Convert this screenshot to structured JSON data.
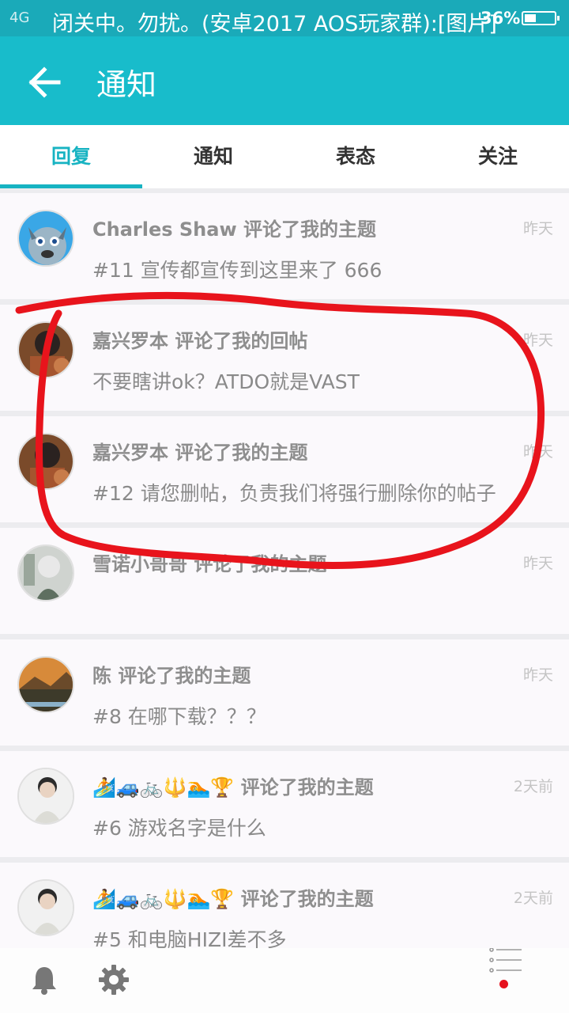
{
  "status_bar": {
    "text": "闭关中。勿扰。(安卓2017 AOS玩家群):[图片]",
    "battery": "36%",
    "signal": "4G"
  },
  "app_bar": {
    "back_icon": "arrow-left-icon",
    "title": "通知"
  },
  "tabs": [
    {
      "label": "回复",
      "active": true
    },
    {
      "label": "通知",
      "active": false
    },
    {
      "label": "表态",
      "active": false
    },
    {
      "label": "关注",
      "active": false
    }
  ],
  "notifications": [
    {
      "title": "Charles Shaw 评论了我的主题",
      "time": "昨天",
      "body": "#11 宣传都宣传到这里来了  666"
    },
    {
      "title": "嘉兴罗本 评论了我的回帖",
      "time": "昨天",
      "body": "不要瞎讲ok？ATDO就是VAST"
    },
    {
      "title": "嘉兴罗本 评论了我的主题",
      "time": "昨天",
      "body": "#12 请您删帖，负责我们将强行删除你的帖子"
    },
    {
      "title": "雪诺小哥哥 评论了我的主题",
      "time": "昨天",
      "body": ""
    },
    {
      "title": "陈 评论了我的主题",
      "time": "昨天",
      "body": "#8 在哪下载？？？"
    },
    {
      "title": "🏄🚙🚲🔱🏊🏆 评论了我的主题",
      "time": "2天前",
      "body": "#6 游戏名字是什么"
    },
    {
      "title": "🏄🚙🚲🔱🏊🏆 评论了我的主题",
      "time": "2天前",
      "body": "#5 和电脑HIZI差不多"
    }
  ],
  "bottom_nav": {
    "bell_icon": "bell-icon",
    "settings_icon": "gear-icon",
    "menu_icon": "menu-icon"
  },
  "colors": {
    "status_bar": "#1aaab9",
    "app_bar": "#18bccb",
    "accent": "#17b3c2",
    "annotation_red": "#e8141c",
    "badge_red": "#e6121e"
  }
}
